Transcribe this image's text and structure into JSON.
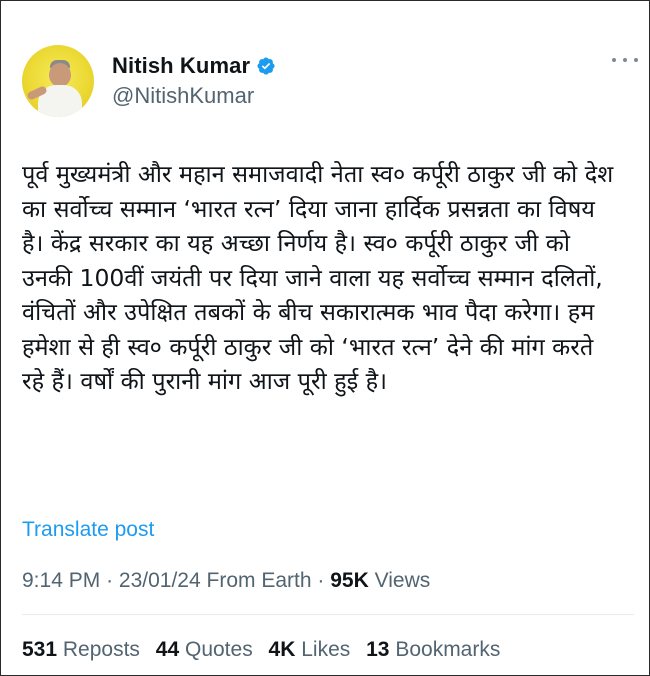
{
  "author": {
    "name": "Nitish Kumar",
    "handle": "@NitishKumar",
    "verified": true
  },
  "tweet": {
    "text": "पूर्व मुख्यमंत्री और महान समाजवादी नेता स्व० कर्पूरी ठाकुर जी को देश का सर्वोच्च सम्मान ‘भारत रत्न’ दिया जाना हार्दिक प्रसन्नता का विषय है। केंद्र सरकार का यह अच्छा निर्णय है। स्व० कर्पूरी ठाकुर जी को उनकी 100वीं जयंती पर दिया जाने वाला यह सर्वोच्च सम्मान दलितों, वंचितों और उपेक्षित तबकों के बीच सकारात्मक भाव पैदा करेगा। हम हमेशा से ही स्व० कर्पूरी ठाकुर जी को ‘भारत रत्न’ देने की मांग करते रहे हैं। वर्षों की पुरानी मांग आज पूरी हुई है।",
    "translate_label": "Translate post"
  },
  "meta": {
    "time": "9:14 PM",
    "date": "23/01/24",
    "location": "From Earth",
    "separator": "·",
    "views_count": "95K",
    "views_label": "Views"
  },
  "stats": {
    "reposts_count": "531",
    "reposts_label": "Reposts",
    "quotes_count": "44",
    "quotes_label": "Quotes",
    "likes_count": "4K",
    "likes_label": "Likes",
    "bookmarks_count": "13",
    "bookmarks_label": "Bookmarks"
  },
  "colors": {
    "link": "#1d9bf0",
    "secondary_text": "#536471",
    "primary_text": "#0f1419",
    "avatar_bg": "#ecd934"
  },
  "icons": {
    "verified": "verified-badge-icon",
    "more": "more-options-icon"
  }
}
